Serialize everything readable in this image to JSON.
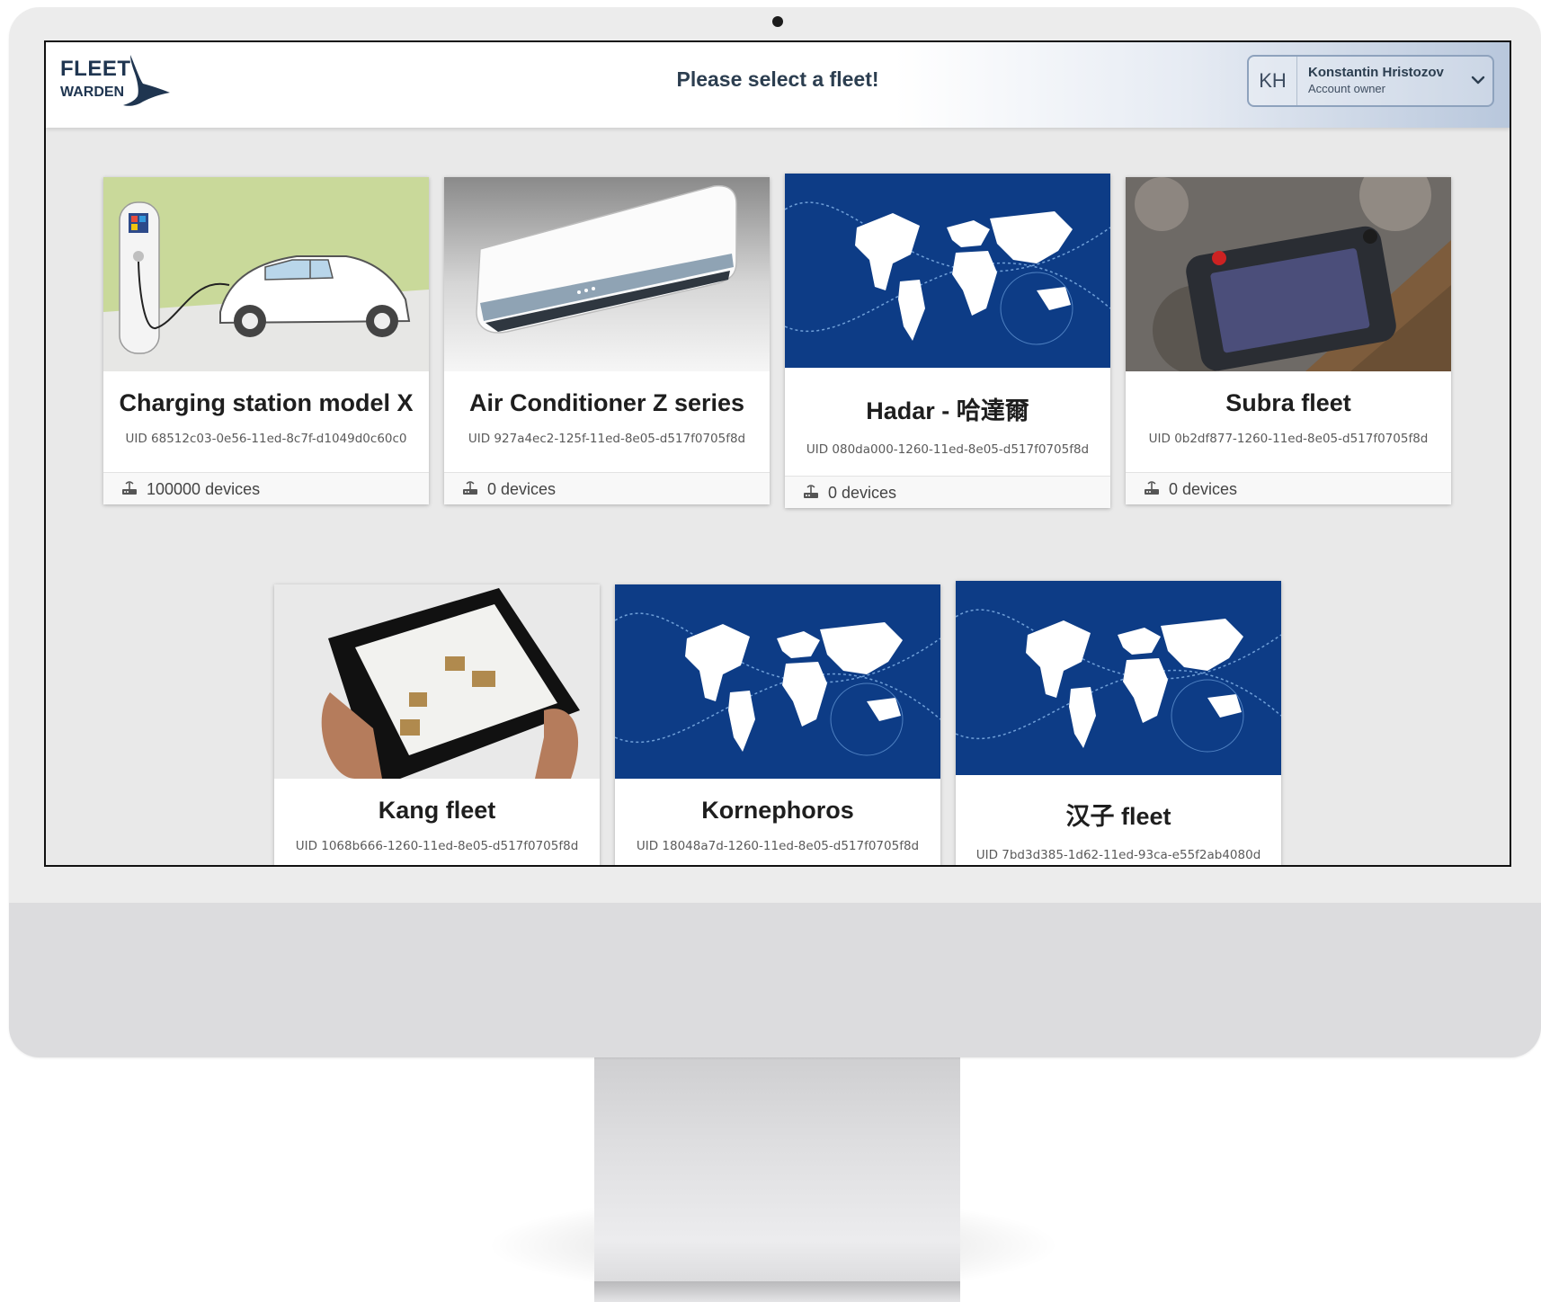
{
  "header": {
    "logo_top": "FLEET",
    "logo_bottom": "WARDEN",
    "title": "Please select a fleet!"
  },
  "account": {
    "initials": "KH",
    "name": "Konstantin Hristozov",
    "role": "Account owner"
  },
  "fleets": [
    {
      "name": "Charging station model X",
      "uid": "UID 68512c03-0e56-11ed-8c7f-d1049d0c60c0",
      "devices": "100000 devices",
      "image": "ev-charging-car"
    },
    {
      "name": "Air Conditioner Z series",
      "uid": "UID 927a4ec2-125f-11ed-8e05-d517f0705f8d",
      "devices": "0 devices",
      "image": "air-conditioner"
    },
    {
      "name": "Hadar - 哈達爾",
      "uid": "UID 080da000-1260-11ed-8e05-d517f0705f8d",
      "devices": "0 devices",
      "image": "world-map"
    },
    {
      "name": "Subra fleet",
      "uid": "UID 0b2df877-1260-11ed-8e05-d517f0705f8d",
      "devices": "0 devices",
      "image": "drone-controller"
    },
    {
      "name": "Kang fleet",
      "uid": "UID 1068b666-1260-11ed-8e05-d517f0705f8d",
      "devices": "",
      "image": "tablet-in-hands"
    },
    {
      "name": "Kornephoros",
      "uid": "UID 18048a7d-1260-11ed-8e05-d517f0705f8d",
      "devices": "",
      "image": "world-map"
    },
    {
      "name": "汉子 fleet",
      "uid": "UID 7bd3d385-1d62-11ed-93ca-e55f2ab4080d",
      "devices": "",
      "image": "world-map"
    }
  ],
  "colors": {
    "brand_navy": "#1f3550",
    "map_blue": "#0d3c86"
  }
}
